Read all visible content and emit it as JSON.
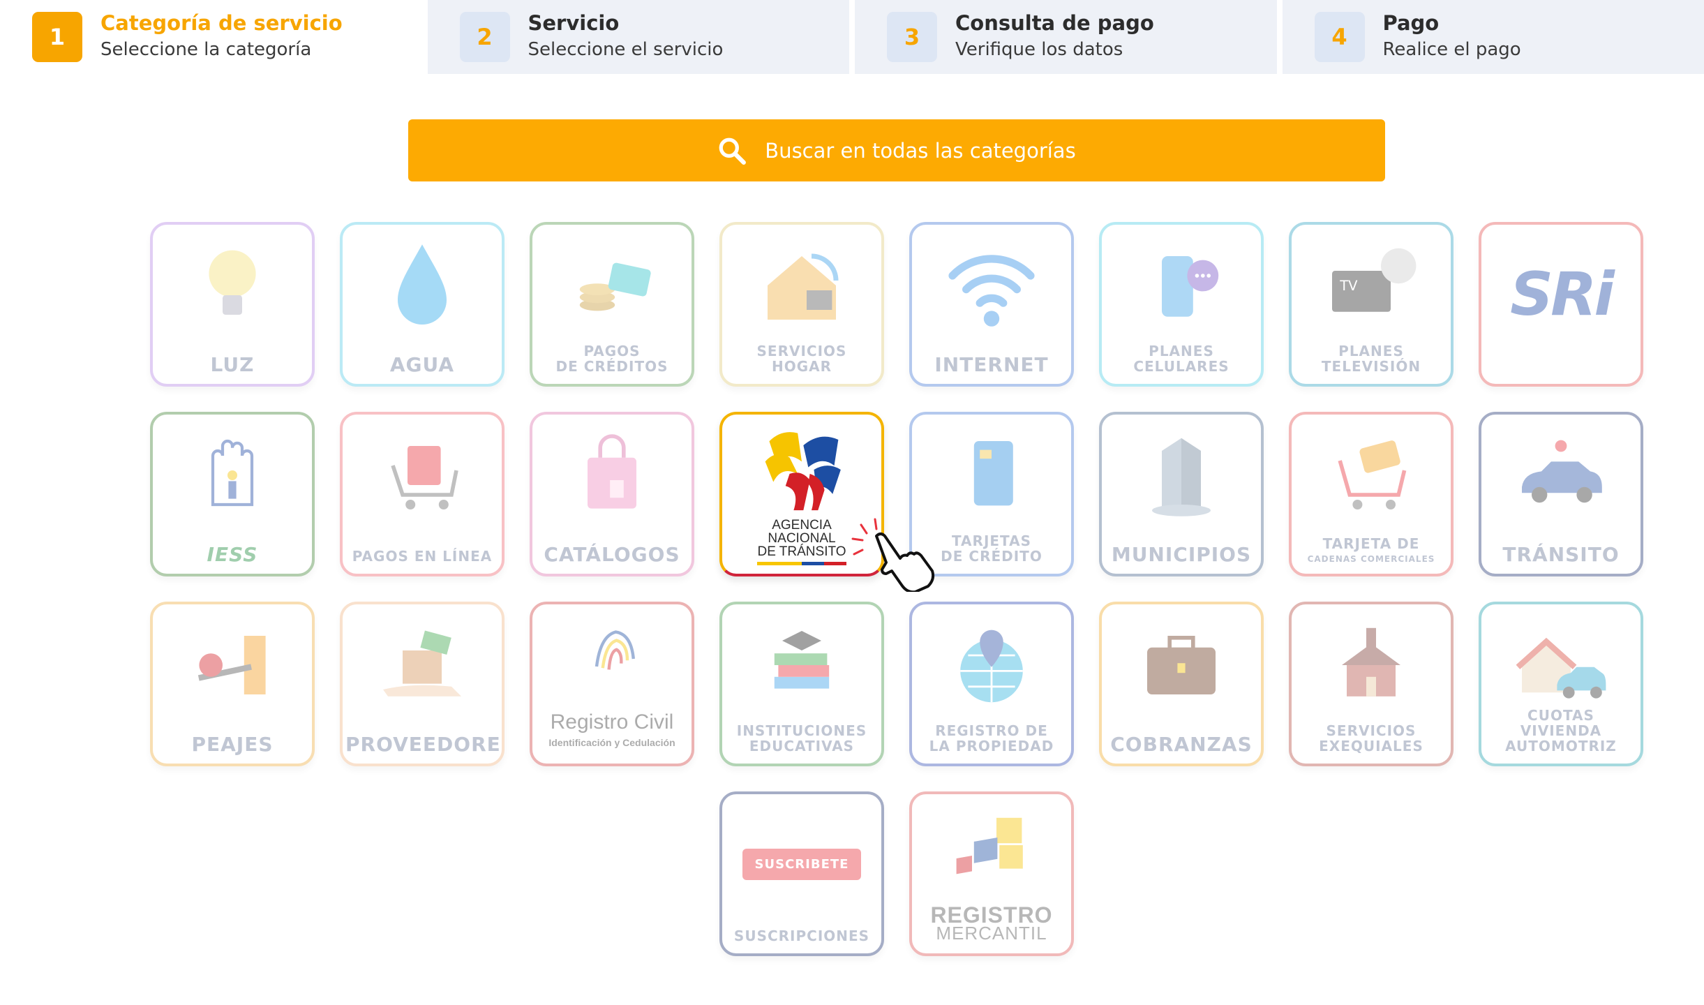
{
  "steps": [
    {
      "number": "1",
      "title": "Categoría de servicio",
      "subtitle": "Seleccione la categoría",
      "active": true
    },
    {
      "number": "2",
      "title": "Servicio",
      "subtitle": "Seleccione el servicio",
      "active": false
    },
    {
      "number": "3",
      "title": "Consulta de pago",
      "subtitle": "Verifique los datos",
      "active": false
    },
    {
      "number": "4",
      "title": "Pago",
      "subtitle": "Realice el pago",
      "active": false
    }
  ],
  "search": {
    "label": "Buscar en todas las categorías"
  },
  "colors": {
    "accent": "#fdaa02",
    "step_active": "#f7a500"
  },
  "categories": [
    {
      "label": "LUZ",
      "icon": "lightbulb-icon"
    },
    {
      "label": "AGUA",
      "icon": "water-drop-icon"
    },
    {
      "label": "PAGOS\nDE CRÉDITOS",
      "icon": "coins-card-icon"
    },
    {
      "label": "SERVICIOS\nHOGAR",
      "icon": "home-services-icon"
    },
    {
      "label": "INTERNET",
      "icon": "wifi-icon"
    },
    {
      "label": "PLANES\nCELULARES",
      "icon": "cellphone-icon"
    },
    {
      "label": "PLANES\nTELEVISIÓN",
      "icon": "tv-satellite-icon"
    },
    {
      "label": "SRi",
      "icon": "sri-logo"
    },
    {
      "label": "IESS",
      "icon": "iess-logo"
    },
    {
      "label": "PAGOS EN LÍNEA",
      "icon": "shopping-cart-icon"
    },
    {
      "label": "CATÁLOGOS",
      "icon": "shopping-bag-icon"
    },
    {
      "label": "AGENCIA\nNACIONAL\nDE TRÁNSITO",
      "icon": "ant-logo"
    },
    {
      "label": "TARJETAS\nDE CRÉDITO",
      "icon": "credit-card-icon"
    },
    {
      "label": "MUNICIPIOS",
      "icon": "building-icon"
    },
    {
      "label": "TARJETA DE",
      "sublabel": "CADENAS COMERCIALES",
      "icon": "cart-card-icon"
    },
    {
      "label": "TRÁNSITO",
      "icon": "car-icon"
    },
    {
      "label": "PEAJES",
      "icon": "toll-barrier-icon"
    },
    {
      "label": "PROVEEDORES",
      "icon": "box-hand-icon"
    },
    {
      "label": "Registro Civil",
      "sublabel": "Identificación y Cedulación",
      "icon": "fingerprint-icon"
    },
    {
      "label": "INSTITUCIONES\nEDUCATIVAS",
      "icon": "books-icon"
    },
    {
      "label": "REGISTRO DE\nLA PROPIEDAD",
      "icon": "globe-pin-icon"
    },
    {
      "label": "COBRANZAS",
      "icon": "briefcase-icon"
    },
    {
      "label": "SERVICIOS\nEXEQUIALES",
      "icon": "chapel-icon"
    },
    {
      "label": "CUOTAS VIVIENDA\nAUTOMOTRIZ",
      "icon": "house-car-icon"
    },
    {
      "label": "SUSCRIPCIONES",
      "badge": "SUSCRIBETE",
      "icon": "subscribe-button-icon"
    },
    {
      "label": "REGISTRO",
      "sublabel": "MERCANTIL",
      "icon": "registro-mercantil-logo"
    }
  ]
}
